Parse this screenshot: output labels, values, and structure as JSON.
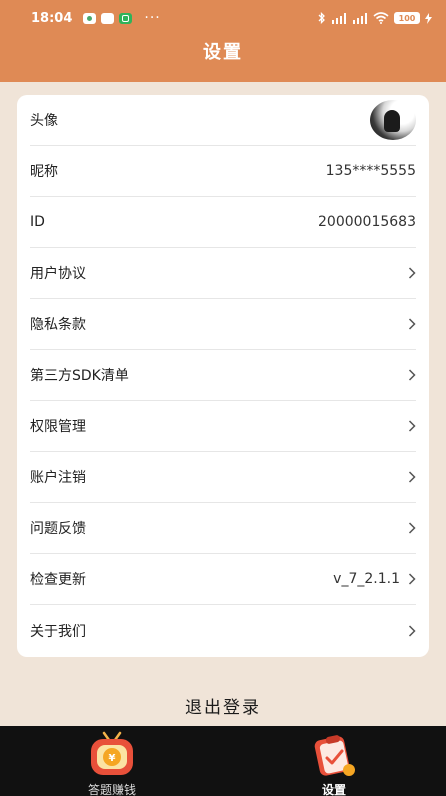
{
  "status_bar": {
    "time": "18:04",
    "notif_icons": [
      "app-notification-icon",
      "gallery-notification-icon",
      "phone-notification-icon"
    ],
    "more": "···",
    "battery": "100"
  },
  "header": {
    "title": "设置"
  },
  "settings": {
    "avatar_label": "头像",
    "nickname_label": "昵称",
    "nickname_value": "135****5555",
    "id_label": "ID",
    "id_value": "20000015683",
    "user_agreement": "用户协议",
    "privacy_policy": "隐私条款",
    "sdk_list": "第三方SDK清单",
    "permissions": "权限管理",
    "account_cancel": "账户注销",
    "feedback": "问题反馈",
    "check_update_label": "检查更新",
    "check_update_value": "v_7_2.1.1",
    "about_us": "关于我们"
  },
  "logout": "退出登录",
  "tabbar": {
    "quiz_label": "答题赚钱",
    "settings_label": "设置"
  },
  "colors": {
    "header": "#df8a55",
    "background": "#f0e4d8",
    "tabbar": "#111111"
  }
}
